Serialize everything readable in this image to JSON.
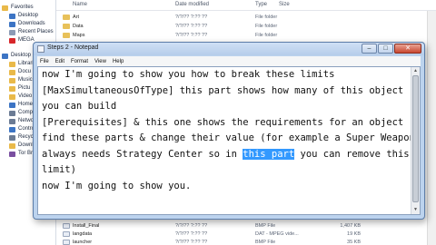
{
  "explorer": {
    "nav": [
      {
        "label": "Favorites",
        "sub": false,
        "color": "#e9b949"
      },
      {
        "label": "Desktop",
        "sub": true,
        "color": "#3c74c4"
      },
      {
        "label": "Downloads",
        "sub": true,
        "color": "#3c74c4"
      },
      {
        "label": "Recent Places",
        "sub": true,
        "color": "#8c9bb5"
      },
      {
        "label": "MEGA",
        "sub": true,
        "color": "#d7262a"
      },
      {
        "label": "Desktop",
        "sub": false,
        "color": "#3c74c4"
      },
      {
        "label": "Libraries",
        "sub": true,
        "color": "#e9b949"
      },
      {
        "label": "Docu",
        "sub": true,
        "color": "#e9b949"
      },
      {
        "label": "Music",
        "sub": true,
        "color": "#e9b949"
      },
      {
        "label": "Pictu",
        "sub": true,
        "color": "#e9b949"
      },
      {
        "label": "Video",
        "sub": true,
        "color": "#e9b949"
      },
      {
        "label": "Homegroup",
        "sub": true,
        "color": "#3c74c4"
      },
      {
        "label": "Compu",
        "sub": true,
        "color": "#6b7b94"
      },
      {
        "label": "Network",
        "sub": true,
        "color": "#6b7b94"
      },
      {
        "label": "Control",
        "sub": true,
        "color": "#3c74c4"
      },
      {
        "label": "Recycl",
        "sub": true,
        "color": "#6b7b94"
      },
      {
        "label": "Downl",
        "sub": true,
        "color": "#e9b949"
      },
      {
        "label": "Tor Br",
        "sub": true,
        "color": "#7a4fa0"
      }
    ],
    "columns": {
      "name": "Name",
      "date": "Date modified",
      "type": "Type",
      "size": "Size"
    },
    "files": [
      {
        "name": "Art",
        "date": "?/?/?? ?:?? ??",
        "type": "File folder",
        "size": "",
        "kind": "folder"
      },
      {
        "name": "Data",
        "date": "?/?/?? ?:?? ??",
        "type": "File folder",
        "size": "",
        "kind": "folder"
      },
      {
        "name": "Maps",
        "date": "?/?/?? ?:?? ??",
        "type": "File folder",
        "size": "",
        "kind": "folder"
      },
      {
        "name": "Install_Final",
        "date": "?/?/?? ?:?? ??",
        "type": "BMP File",
        "size": "1,407 KB",
        "kind": "doc"
      },
      {
        "name": "langdata",
        "date": "?/?/?? ?:?? ??",
        "type": "DAT - MPEG vide...",
        "size": "19 KB",
        "kind": "doc"
      },
      {
        "name": "launcher",
        "date": "?/?/?? ?:?? ??",
        "type": "BMP File",
        "size": "35 KB",
        "kind": "doc"
      }
    ]
  },
  "notepad": {
    "title": "Steps 2 - Notepad",
    "menu": [
      "File",
      "Edit",
      "Format",
      "View",
      "Help"
    ],
    "controls": {
      "minimize": "–",
      "maximize": "□",
      "close": "✕"
    },
    "lines": [
      {
        "text": "now I'm going to show you how to break these limits"
      },
      {
        "text": "[MaxSimultaneousOfType] this part shows how many of this object"
      },
      {
        "text": "you can build"
      },
      {
        "text": "[Prerequisites] & this one shows the requirements for an object"
      },
      {
        "text": "find these parts & change their value (for example a Super Weapon"
      },
      {
        "text": "always needs Strategy Center so in ",
        "selected": "this part",
        "after": " you can remove this"
      },
      {
        "text": "limit)"
      },
      {
        "text": "now I'm going to show you."
      }
    ]
  },
  "colors": {
    "selection": "#3399ff",
    "titlebar": "#bcd3ee",
    "close_button": "#c9472f"
  }
}
